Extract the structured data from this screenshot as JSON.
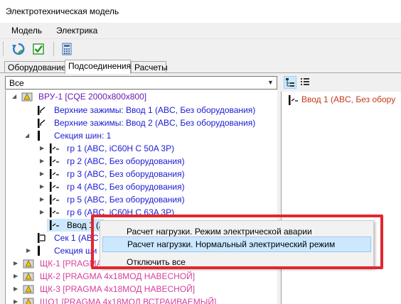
{
  "window": {
    "title": "Электротехническая модель"
  },
  "menu": {
    "items": [
      "Модель",
      "Электрика"
    ]
  },
  "toolbar": {
    "refresh_icon": "refresh-icon",
    "check_icon": "checkbox-icon",
    "calc_icon": "calculator-icon"
  },
  "tabs": [
    {
      "label": "Оборудование",
      "active": false
    },
    {
      "label": "Подсоединения",
      "active": true
    },
    {
      "label": "Расчеты",
      "active": false
    }
  ],
  "filter": {
    "value": "Все"
  },
  "tree": {
    "nodes": [
      {
        "label": "ВРУ-1 [CQE 2000x800x800]",
        "color": "#6a19b5"
      },
      {
        "label": "Верхние зажимы: Ввод 1 (ABC, Без оборудования)",
        "color": "#1a1ad6"
      },
      {
        "label": "Верхние зажимы: Ввод 2 (ABC, Без оборудования)",
        "color": "#1a1ad6"
      },
      {
        "label": "Секция шин: 1",
        "color": "#1a1ad6"
      },
      {
        "label": "гр 1 (ABC, iC60H C 50A 3P)",
        "color": "#1a1ad6"
      },
      {
        "label": "гр 2 (ABC, Без оборудования)",
        "color": "#1a1ad6"
      },
      {
        "label": "гр 3 (ABC, Без оборудования)",
        "color": "#1a1ad6"
      },
      {
        "label": "гр 4 (ABC, Без оборудования)",
        "color": "#1a1ad6"
      },
      {
        "label": "гр 5 (ABC, Без оборудования)",
        "color": "#1a1ad6"
      },
      {
        "label": "гр 6 (ABC, iC60H C 63A 3P)",
        "color": "#1a1ad6"
      },
      {
        "label": "Ввод 1 (A",
        "color": "#000000"
      },
      {
        "label": "Сек 1 (ABC",
        "color": "#1a1ad6"
      },
      {
        "label": "Секция ши",
        "color": "#1a1ad6"
      },
      {
        "label": "ЩК-1 [PRAGMA",
        "color": "#d63d9c"
      },
      {
        "label": "ЩК-2 [PRAGMA 4x18МОД НАВЕСНОЙ]",
        "color": "#d63d9c"
      },
      {
        "label": "ЩК-3 [PRAGMA 4x18МОД НАВЕСНОЙ]",
        "color": "#d63d9c"
      },
      {
        "label": "ЩО1 [PRAGMA 4x18МОД ВСТРАИВАЕМЫЙ]",
        "color": "#d63d9c"
      }
    ]
  },
  "right_panel": {
    "node_label": "Ввод 1 (ABC, Без обору"
  },
  "context_menu": {
    "items": [
      {
        "label": "Расчет нагрузки. Режим электрической аварии",
        "highlighted": false
      },
      {
        "label": "Расчет нагрузки. Нормальный электрический режим",
        "highlighted": true
      },
      {
        "label": "Отключить все",
        "highlighted": false
      }
    ]
  },
  "colors": {
    "highlight": "#cce8ff",
    "annotation_red": "#e3262d"
  }
}
